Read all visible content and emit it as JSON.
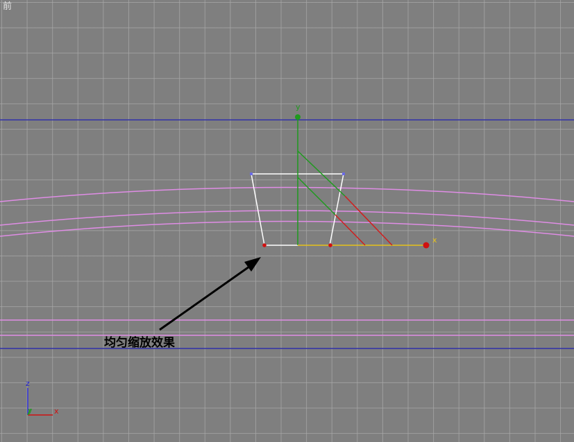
{
  "viewport": {
    "label": "前",
    "background": "#7f7f7f",
    "grid_color": "#a8a8a8"
  },
  "gizmo": {
    "y_label": "y",
    "x_label": "x",
    "y_color": "#1f9a1f",
    "x_color": "#e6c21a",
    "diag_color": "#d01e1e"
  },
  "annotation": {
    "text": "均匀缩放效果",
    "arrow_color": "#000000"
  },
  "axis_tripod": {
    "z_label": "z",
    "x_label": "x",
    "y_label": "y"
  },
  "scene_colors": {
    "horizon_line": "#3030a8",
    "curve": "#e08de6",
    "object_edge": "#ffffff",
    "vertex_red": "#d01010",
    "vertex_blue": "#6a6ae6"
  }
}
